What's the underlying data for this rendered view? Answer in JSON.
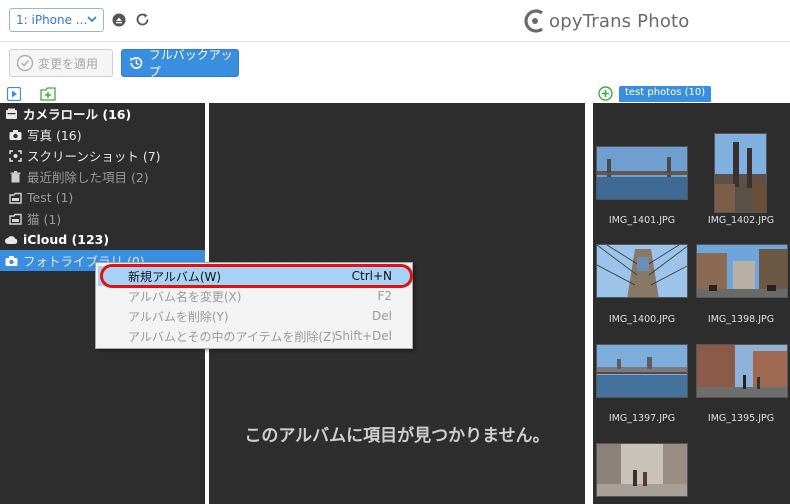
{
  "header": {
    "device_label": "1: iPhone ...",
    "logo_text": "opyTrans Photo"
  },
  "toolbar": {
    "apply_label": "変更を適用",
    "backup_label": "フルバックアップ"
  },
  "album_tab": "test photos (10)",
  "tree": {
    "items": [
      {
        "label": "カメラロール (16)"
      },
      {
        "label": "写真 (16)"
      },
      {
        "label": "スクリーンショット (7)"
      },
      {
        "label": "最近削除した項目 (2)"
      },
      {
        "label": "Test (1)"
      },
      {
        "label": "猫 (1)"
      },
      {
        "label": "iCloud (123)"
      },
      {
        "label": "フォトライブラリ (0)"
      }
    ]
  },
  "middle": {
    "empty_message": "このアルバムに項目が見つかりません。"
  },
  "context_menu": {
    "items": [
      {
        "label": "新規アルバム(W)",
        "shortcut": "Ctrl+N"
      },
      {
        "label": "アルバム名を変更(X)",
        "shortcut": "F2"
      },
      {
        "label": "アルバムを削除(Y)",
        "shortcut": "Del"
      },
      {
        "label": "アルバムとその中のアイテムを削除(Z)",
        "shortcut": "Shift+Del"
      }
    ]
  },
  "photos": [
    {
      "name": "IMG_1401.JPG"
    },
    {
      "name": "IMG_1402.JPG"
    },
    {
      "name": "IMG_1400.JPG"
    },
    {
      "name": "IMG_1398.JPG"
    },
    {
      "name": "IMG_1397.JPG"
    },
    {
      "name": "IMG_1395.JPG"
    },
    {
      "name": ""
    }
  ],
  "colors": {
    "accent": "#3a8ee0",
    "panel_bg": "#2d2d2d",
    "highlight_ring": "#e41010"
  }
}
